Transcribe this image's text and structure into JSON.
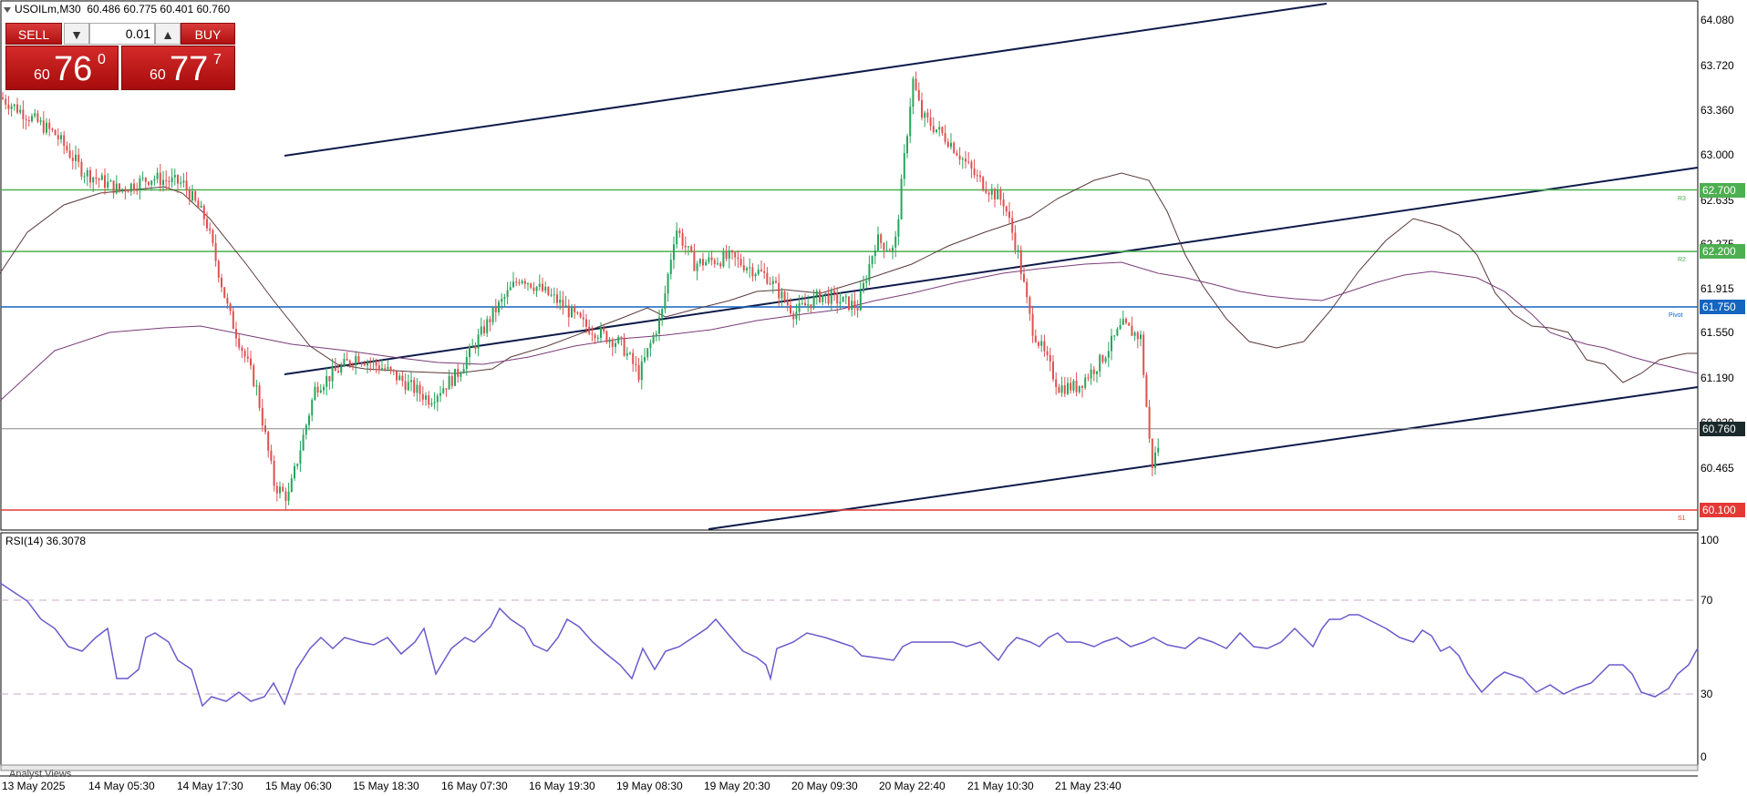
{
  "header": {
    "symbol": "USOILm,M30",
    "ohlc": "60.486 60.775 60.401 60.760"
  },
  "trade_panel": {
    "sell_label": "SELL",
    "buy_label": "BUY",
    "lot_value": "0.01",
    "down_arrow": "▼",
    "up_arrow": "▲",
    "sell_price_prefix": "60",
    "sell_price_big": "76",
    "sell_price_sup": "0",
    "buy_price_prefix": "60",
    "buy_price_big": "77",
    "buy_price_sup": "7"
  },
  "price_axis": {
    "ticks": [
      "64.080",
      "63.720",
      "63.360",
      "63.000",
      "62.635",
      "62.275",
      "61.915",
      "61.550",
      "61.190",
      "60.830",
      "60.465"
    ],
    "ymin": 60.0,
    "ymax": 64.25
  },
  "levels": [
    {
      "value": 62.7,
      "label": "62.700",
      "tiny": "R3",
      "color": "#4caf50"
    },
    {
      "value": 62.2,
      "label": "62.200",
      "tiny": "R2",
      "color": "#4caf50"
    },
    {
      "value": 61.75,
      "label": "61.750",
      "tiny": "Pivot",
      "color": "#1565c0"
    },
    {
      "value": 60.1,
      "label": "60.100",
      "tiny": "S1",
      "color": "#e53935"
    }
  ],
  "current_price": {
    "value": 60.76,
    "label": "60.760"
  },
  "rsi": {
    "title": "RSI(14) 36.3078",
    "ticks": [
      "100",
      "70",
      "30",
      "0"
    ]
  },
  "time_axis": [
    "13 May 2025",
    "14 May 05:30",
    "14 May 17:30",
    "15 May 06:30",
    "15 May 18:30",
    "16 May 07:30",
    "16 May 19:30",
    "19 May 08:30",
    "19 May 20:30",
    "20 May 09:30",
    "20 May 22:40",
    "21 May 10:30",
    "21 May 23:40"
  ],
  "analyst_views": "Analyst Views",
  "chart_data": {
    "type": "candlestick",
    "symbol": "USOILm",
    "timeframe": "M30",
    "key_points": [
      {
        "x": "13 May 2025",
        "y": 63.45
      },
      {
        "x": "14 May 05:30",
        "y": 62.85
      },
      {
        "x": "14 May 17:30",
        "y": 62.45
      },
      {
        "x": "15 May 06:30",
        "y": 60.2
      },
      {
        "x": "15 May 18:30",
        "y": 61.35
      },
      {
        "x": "16 May 07:30",
        "y": 61.2
      },
      {
        "x": "16 May 19:30",
        "y": 61.75
      },
      {
        "x": "19 May 08:30",
        "y": 61.2
      },
      {
        "x": "19 May 20:30",
        "y": 62.15
      },
      {
        "x": "20 May 09:30",
        "y": 61.9
      },
      {
        "x": "20 May 22:40",
        "y": 63.4
      },
      {
        "x": "21 May 10:30",
        "y": 62.6
      },
      {
        "x": "21 May 23:40",
        "y": 61.1
      }
    ],
    "last_price": 60.76,
    "ylim": [
      60.0,
      64.25
    ],
    "grid": false
  }
}
